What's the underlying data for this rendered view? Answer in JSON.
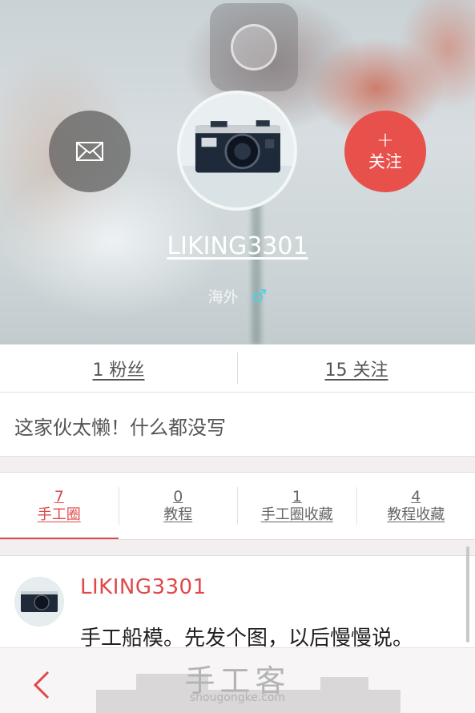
{
  "profile": {
    "username": "LIKING3301",
    "location": "海外",
    "gender_symbol": "♂",
    "follow_plus": "+",
    "follow_label": "关注"
  },
  "stats": {
    "fans": "1 粉丝",
    "following": "15 关注"
  },
  "bio": "这家伙太懒！什么都没写",
  "tabs": [
    {
      "count": "7",
      "label": "手工圈",
      "active": true
    },
    {
      "count": "0",
      "label": "教程",
      "active": false
    },
    {
      "count": "1",
      "label": "手工圈收藏",
      "active": false
    },
    {
      "count": "4",
      "label": "教程收藏",
      "active": false
    }
  ],
  "post": {
    "author": "LIKING3301",
    "content": "手工船模。先发个图，以后慢慢说。"
  },
  "bottom_bar": {
    "brand": "手工客",
    "brand_url": "shougongke.com",
    "back_icon": "chevron-left-icon"
  },
  "colors": {
    "accent": "#e0484a",
    "follow_button": "#e8504b",
    "gender": "#4ed0e0"
  }
}
